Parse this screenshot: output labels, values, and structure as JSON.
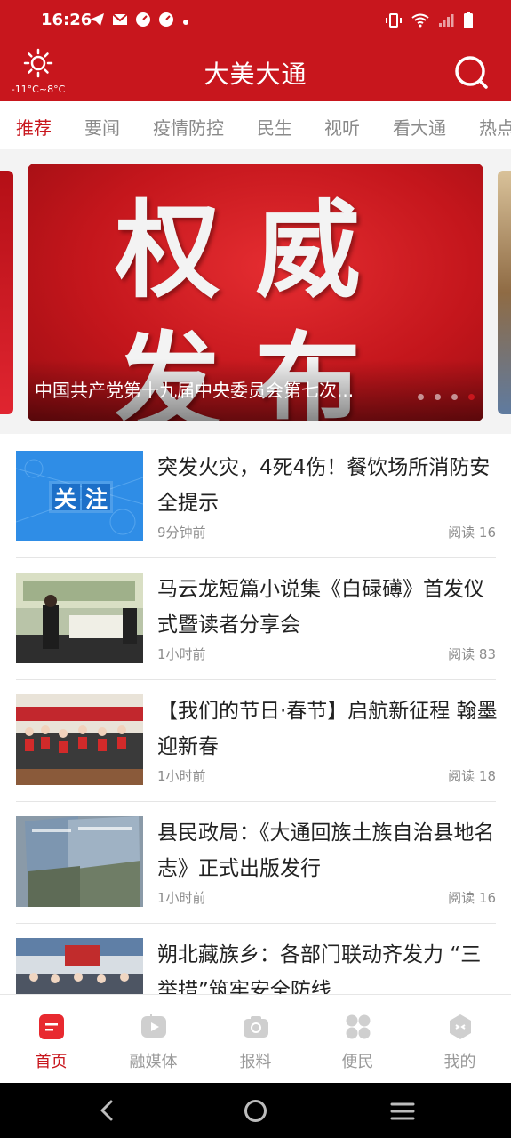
{
  "status_bar": {
    "time": "16:26",
    "left_icons": [
      "telegram-icon",
      "mail-icon",
      "speedometer-icon",
      "speedometer-icon",
      "dot-icon"
    ],
    "right_icons": [
      "vibrate-icon",
      "wifi-icon",
      "signal-icon",
      "battery-icon"
    ]
  },
  "header": {
    "title": "大美大通",
    "weather_range": "-11°C~8°C",
    "colors": {
      "brand": "#c8161d"
    }
  },
  "tabs": [
    "推荐",
    "要闻",
    "疫情防控",
    "民生",
    "视听",
    "看大通",
    "热点"
  ],
  "active_tab": 0,
  "carousel": {
    "image_text_line1": "权威",
    "image_text_line2": "发布",
    "caption": "中国共产党第十九届中央委员会第七次...",
    "dot_count": 4,
    "active_dot": 3
  },
  "news": [
    {
      "title": "突发火灾，4死4伤！餐饮场所消防安全提示",
      "time": "9分钟前",
      "reads": "阅读 16",
      "thumb_label": "关注"
    },
    {
      "title": "马云龙短篇小说集《白碌礡》首发仪式暨读者分享会",
      "time": "1小时前",
      "reads": "阅读 83"
    },
    {
      "title": "【我们的节日·春节】启航新征程 翰墨迎新春",
      "time": "1小时前",
      "reads": "阅读 18"
    },
    {
      "title": "县民政局：《大通回族土族自治县地名志》正式出版发行",
      "time": "1小时前",
      "reads": "阅读 16"
    },
    {
      "title": "朔北藏族乡：各部门联动齐发力 “三举措”筑牢安全防线",
      "time": "",
      "reads": ""
    }
  ],
  "bottom_nav": [
    {
      "label": "首页",
      "icon": "home-icon"
    },
    {
      "label": "融媒体",
      "icon": "media-play-icon"
    },
    {
      "label": "报料",
      "icon": "camera-icon"
    },
    {
      "label": "便民",
      "icon": "grid-icon"
    },
    {
      "label": "我的",
      "icon": "profile-icon"
    }
  ],
  "active_nav": 0
}
